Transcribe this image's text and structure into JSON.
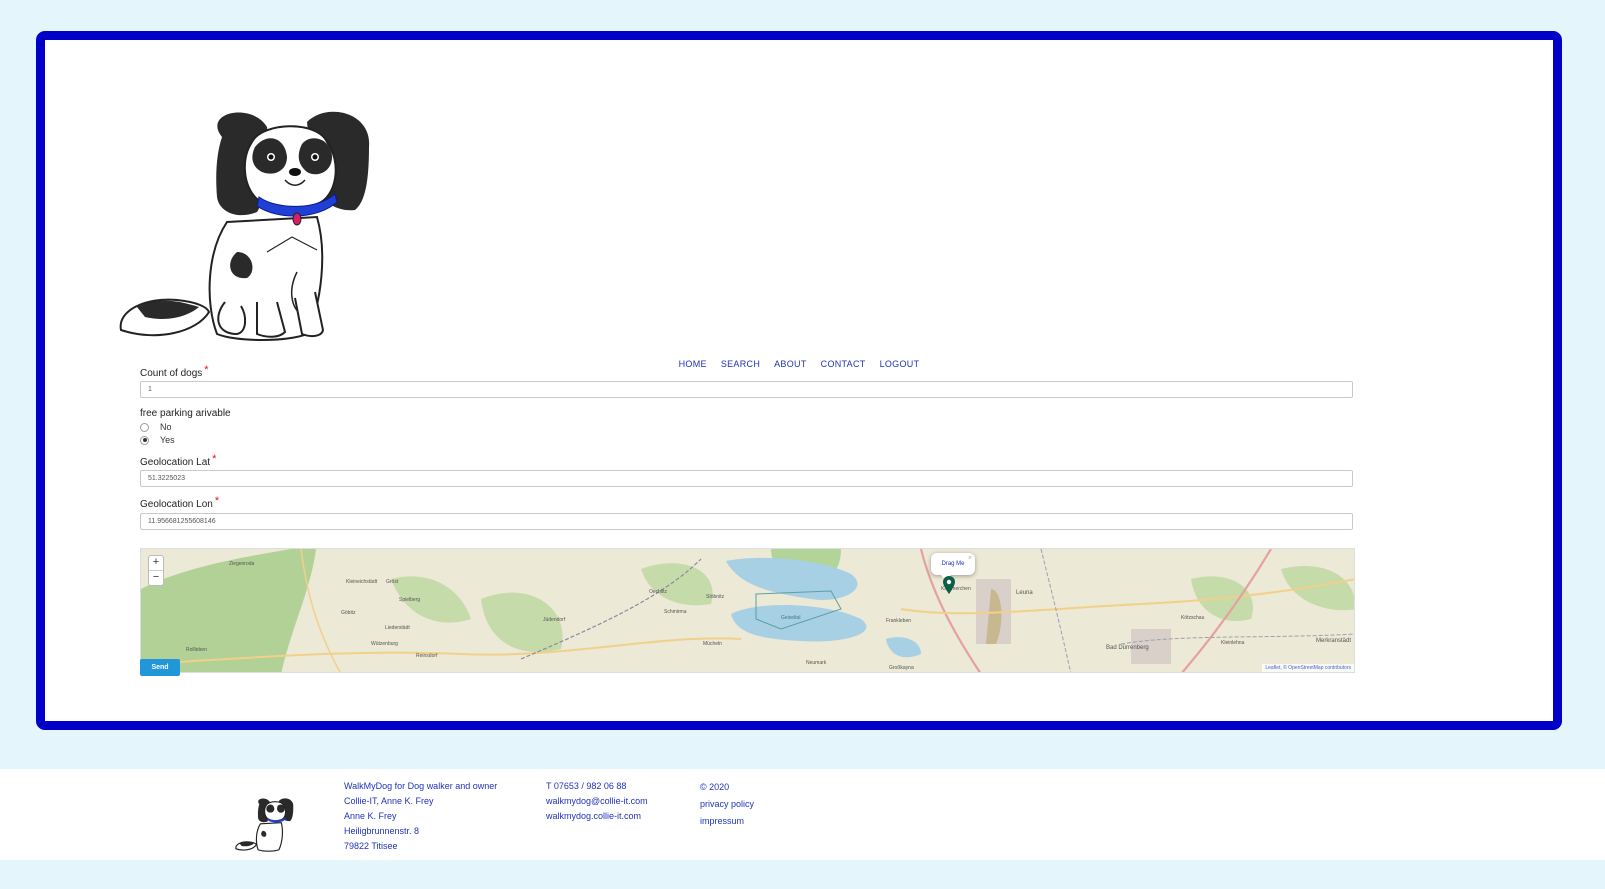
{
  "nav": {
    "items": [
      "HOME",
      "SEARCH",
      "ABOUT",
      "CONTACT",
      "LOGOUT"
    ]
  },
  "form": {
    "count_label": "Count of dogs",
    "count_value": "1",
    "parking_label": "free parking arivable",
    "parking_options": [
      "No",
      "Yes"
    ],
    "parking_selected": "Yes",
    "lat_label": "Geolocation Lat",
    "lat_value": "51.3225023",
    "lon_label": "Geolocation Lon",
    "lon_value": "11.956681255608146",
    "required_mark": "*",
    "send_label": "Send"
  },
  "map": {
    "zoom_in": "+",
    "zoom_out": "−",
    "popup_text": "Drag Me",
    "popup_close": "×",
    "attribution": "Leaflet, © OpenStreetMap contributors",
    "places": [
      "Ziegenroda",
      "Kleineichstädt",
      "Gröst",
      "Spielberg",
      "Göbitz",
      "Liederstädt",
      "Wützenburg",
      "Reinsdorf",
      "Rollleben",
      "Oechlitz",
      "Schmirma",
      "Jüdendorf",
      "Stöbnitz",
      "Mücheln",
      "Neumark",
      "Kämmerchen",
      "Frankleben",
      "Leuna",
      "Bad Dürrenberg",
      "Kötzschau",
      "Merkranstädt",
      "Großkayna",
      "Geiseltal",
      "Kleinlehna"
    ],
    "colors": {
      "land": "#ece9d6",
      "forest": "#a8cc8c",
      "water": "#a7d0e4",
      "road": "#e6a0a0",
      "marker": "#0b5e48"
    }
  },
  "footer": {
    "col1": [
      "WalkMyDog for Dog walker and owner",
      "Collie-IT, Anne K. Frey",
      "Anne K. Frey",
      "Heiligbrunnenstr. 8",
      "79822 Titisee"
    ],
    "col2": [
      "T 07653 / 982 06 88",
      "walkmydog@collie-it.com",
      "walkmydog.collie-it.com"
    ],
    "col3": [
      "© 2020",
      "privacy policy",
      "impressum"
    ]
  },
  "colors": {
    "frame": "#0000c8",
    "background": "#e4f5fc",
    "link": "#1f33b8",
    "button": "#2196d9"
  }
}
